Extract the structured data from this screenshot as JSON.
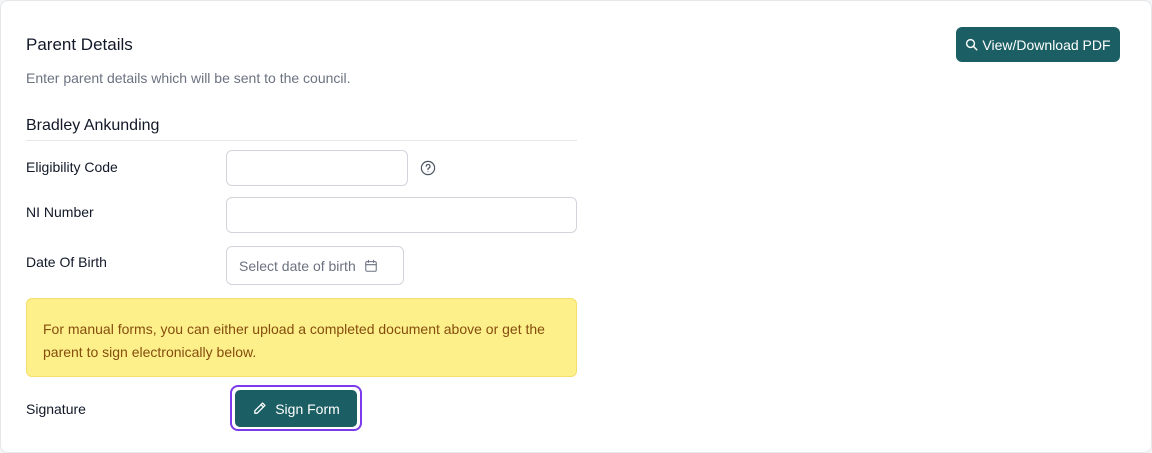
{
  "section": {
    "title": "Parent Details",
    "subtitle": "Enter parent details which will be sent to the council.",
    "pdf_button_label": "View/Download PDF"
  },
  "parent": {
    "name": "Bradley Ankunding"
  },
  "fields": {
    "eligibility_code": {
      "label": "Eligibility Code",
      "value": ""
    },
    "ni_number": {
      "label": "NI Number",
      "value": ""
    },
    "date_of_birth": {
      "label": "Date Of Birth",
      "placeholder": "Select date of birth"
    }
  },
  "notice": {
    "text": "For manual forms, you can either upload a completed document above or get the parent to sign electronically below."
  },
  "signature": {
    "label": "Signature",
    "button_label": "Sign Form"
  },
  "icons": {
    "pdf_button": "search-icon",
    "eligibility_help": "question-circle-icon",
    "date_picker": "calendar-icon",
    "sign_button": "pencil-icon"
  },
  "colors": {
    "primary": "#1b5e63",
    "notice_bg": "#fdf08a",
    "notice_text": "#854d0e",
    "focus_ring": "#7c3aed"
  }
}
